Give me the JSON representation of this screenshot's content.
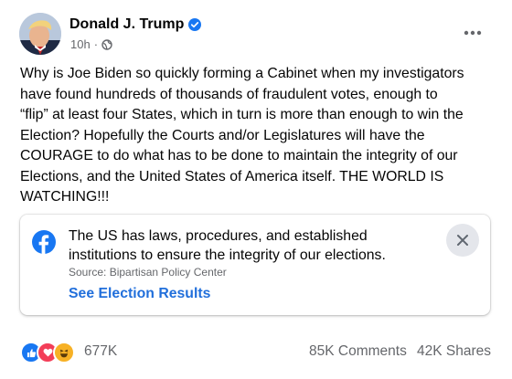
{
  "post": {
    "author": "Donald J. Trump",
    "timestamp": "10h",
    "audience_icon": "globe-icon",
    "text": "Why is Joe Biden so quickly forming a Cabinet when my investigators\nhave found hundreds of thousands of fraudulent votes, enough to\n“flip” at least four States, which in turn is more than enough to win the\nElection? Hopefully the Courts and/or Legislatures will have the\nCOURAGE to do what has to be done to maintain the integrity of our\nElections,  and the United States of America itself. THE WORLD IS\nWATCHING!!!"
  },
  "info_card": {
    "text": "The US has laws, procedures, and established\ninstitutions to ensure the integrity of our elections.",
    "source": "Source: Bipartisan Policy Center",
    "link": "See Election Results"
  },
  "engagement": {
    "reactions": "677K",
    "comments": "85K Comments",
    "shares": "42K Shares"
  },
  "colors": {
    "facebook_blue": "#1877f2",
    "link_blue": "#216fdb",
    "like_blue": "#1877f2",
    "love_red": "#f33e58",
    "haha_yellow": "#f7b125",
    "secondary_text": "#65676b"
  }
}
